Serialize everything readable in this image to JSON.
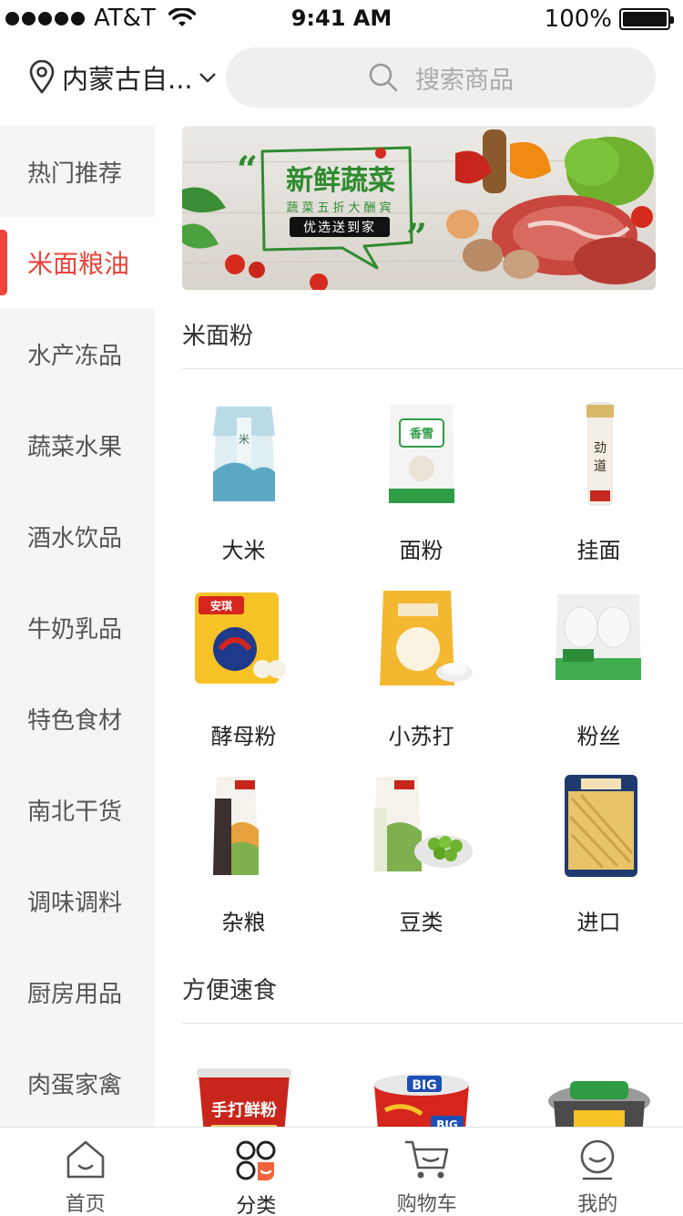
{
  "status_bar": {
    "carrier": "AT&T",
    "time": "9:41 AM",
    "battery": "100%"
  },
  "header": {
    "location": "内蒙古自...",
    "search_placeholder": "搜索商品"
  },
  "sidebar": {
    "items": [
      {
        "label": "热门推荐",
        "active": false
      },
      {
        "label": "米面粮油",
        "active": true
      },
      {
        "label": "水产冻品",
        "active": false
      },
      {
        "label": "蔬菜水果",
        "active": false
      },
      {
        "label": "酒水饮品",
        "active": false
      },
      {
        "label": "牛奶乳品",
        "active": false
      },
      {
        "label": "特色食材",
        "active": false
      },
      {
        "label": "南北干货",
        "active": false
      },
      {
        "label": "调味调料",
        "active": false
      },
      {
        "label": "厨房用品",
        "active": false
      },
      {
        "label": "肉蛋家禽",
        "active": false
      }
    ]
  },
  "banner": {
    "title": "新鲜蔬菜",
    "subtitle": "蔬菜五折大酬宾",
    "tag": "优选送到家"
  },
  "sections": [
    {
      "title": "米面粉",
      "items": [
        {
          "label": "大米",
          "icon": "rice-bag-icon"
        },
        {
          "label": "面粉",
          "icon": "flour-bag-icon"
        },
        {
          "label": "挂面",
          "icon": "noodle-pack-icon"
        },
        {
          "label": "酵母粉",
          "icon": "yeast-box-icon"
        },
        {
          "label": "小苏打",
          "icon": "baking-soda-icon"
        },
        {
          "label": "粉丝",
          "icon": "vermicelli-icon"
        },
        {
          "label": "杂粮",
          "icon": "grain-bag-icon"
        },
        {
          "label": "豆类",
          "icon": "bean-bag-icon"
        },
        {
          "label": "进口",
          "icon": "pasta-bag-icon"
        }
      ]
    },
    {
      "title": "方便速食",
      "items": [
        {
          "label": "",
          "icon": "instant-noodle-cup-icon",
          "print": "手打鲜粉"
        },
        {
          "label": "",
          "icon": "big-noodle-bowl-icon",
          "print": "BIG"
        },
        {
          "label": "",
          "icon": "self-heating-pot-icon"
        }
      ]
    }
  ],
  "tabbar": {
    "tabs": [
      {
        "label": "首页",
        "icon": "home-icon",
        "active": false
      },
      {
        "label": "分类",
        "icon": "category-icon",
        "active": true
      },
      {
        "label": "购物车",
        "icon": "cart-icon",
        "active": false
      },
      {
        "label": "我的",
        "icon": "profile-icon",
        "active": false
      }
    ]
  },
  "colors": {
    "accent": "#e8453c",
    "sidebar_bg": "#f5f5f5",
    "search_bg": "#efefef"
  }
}
